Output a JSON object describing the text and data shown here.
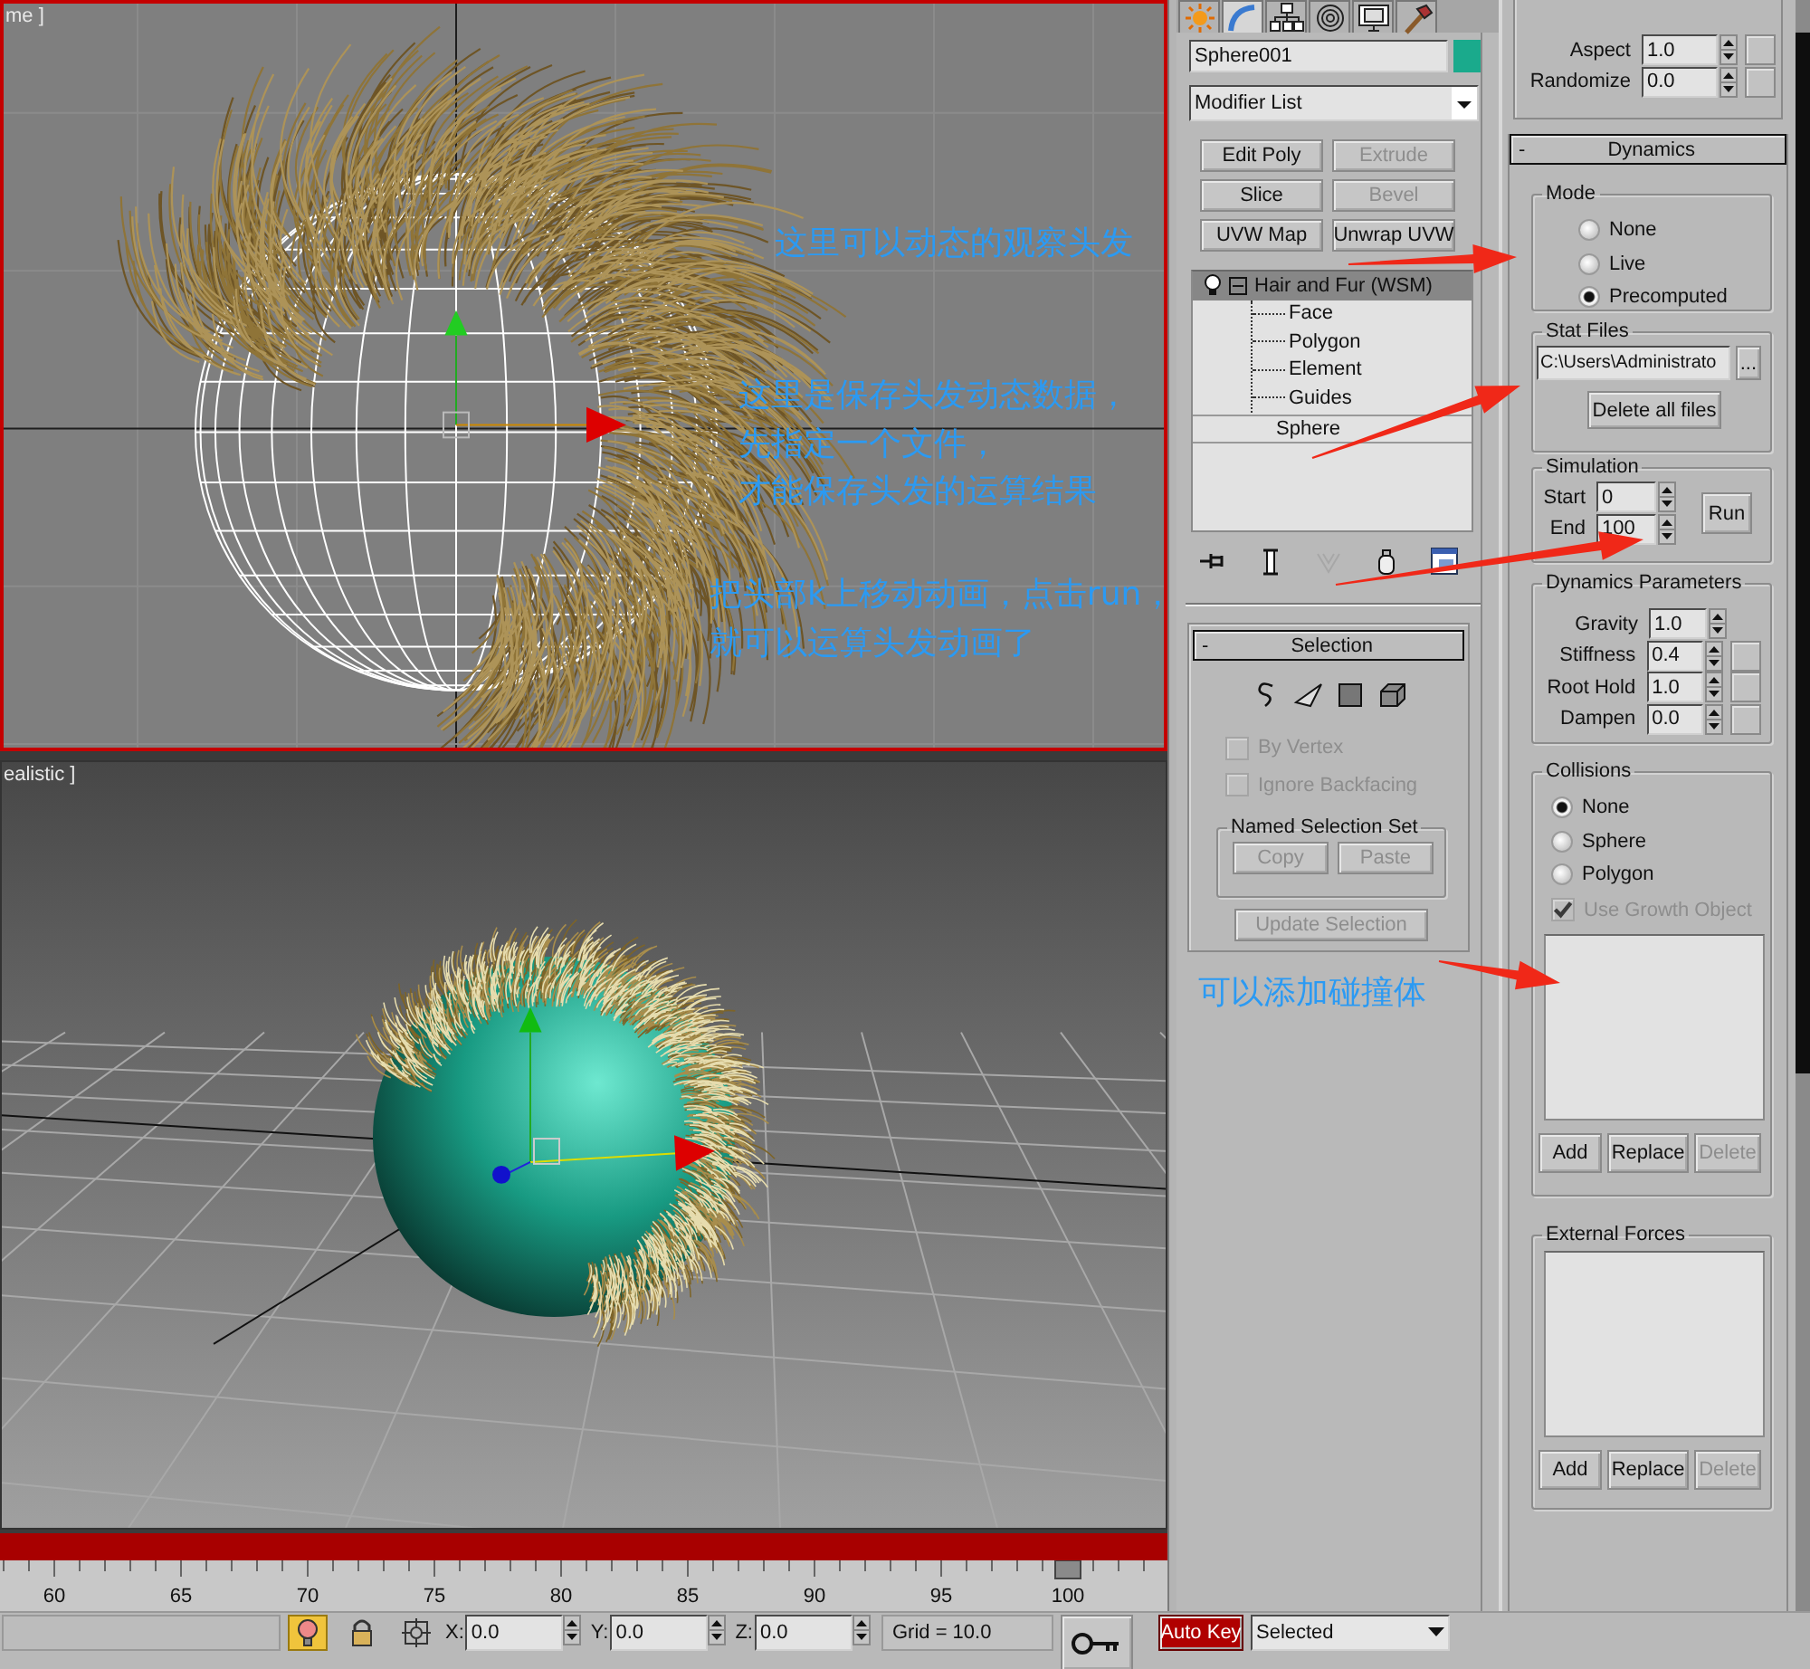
{
  "viewports": [
    {
      "label": "me ]",
      "active": true,
      "kind": "wireframe"
    },
    {
      "label": "ealistic ]",
      "active": false,
      "kind": "shaded"
    }
  ],
  "timeline": {
    "ticks": [
      "60",
      "65",
      "70",
      "75",
      "80",
      "85",
      "90",
      "95",
      "100"
    ]
  },
  "command_panel": {
    "tabs": [
      {
        "kind": "create",
        "selected": false
      },
      {
        "kind": "modify",
        "selected": true
      },
      {
        "kind": "hierarchy",
        "selected": false
      },
      {
        "kind": "motion",
        "selected": false
      },
      {
        "kind": "display",
        "selected": false
      },
      {
        "kind": "utilities",
        "selected": false
      }
    ],
    "object_name": "Sphere001",
    "modifier_list": "Modifier List",
    "modifier_buttons": [
      {
        "label": "Edit Poly",
        "disabled": false
      },
      {
        "label": "Extrude",
        "disabled": true
      },
      {
        "label": "Slice",
        "disabled": false
      },
      {
        "label": "Bevel",
        "disabled": true
      },
      {
        "label": "UVW Map",
        "disabled": false
      },
      {
        "label": "Unwrap UVW",
        "disabled": false
      }
    ],
    "stack": [
      {
        "label": "Hair and Fur (WSM)",
        "selected": true,
        "expanded": true,
        "children": [
          {
            "label": "Face"
          },
          {
            "label": "Polygon"
          },
          {
            "label": "Element"
          },
          {
            "label": "Guides"
          }
        ]
      },
      {
        "label": "Sphere",
        "selected": false
      }
    ],
    "stack_tools": [
      {
        "kind": "pin",
        "disabled": false
      },
      {
        "kind": "end-result",
        "disabled": false
      },
      {
        "kind": "unique",
        "disabled": true
      },
      {
        "kind": "remove",
        "disabled": false
      },
      {
        "kind": "configure",
        "disabled": false
      }
    ],
    "selection_rollout": {
      "collapse": "-",
      "title": "Selection",
      "levels": [
        {
          "kind": "guide"
        },
        {
          "kind": "face"
        },
        {
          "kind": "polygon"
        },
        {
          "kind": "element"
        }
      ],
      "options": [
        {
          "label": "By Vertex",
          "checked": false,
          "disabled": true
        },
        {
          "label": "Ignore Backfacing",
          "checked": false,
          "disabled": true
        }
      ],
      "named_selection_set": {
        "title": "Named Selection Set",
        "buttons": [
          {
            "label": "Copy",
            "disabled": true
          },
          {
            "label": "Paste",
            "disabled": true
          }
        ]
      },
      "update_button": {
        "label": "Update Selection",
        "disabled": true
      }
    }
  },
  "hair_panel": {
    "top_fields": [
      {
        "label": "Aspect",
        "value": "1.0",
        "map_slot": true
      },
      {
        "label": "Randomize",
        "value": "0.0",
        "map_slot": true
      }
    ],
    "dynamics": {
      "collapse": "-",
      "title": "Dynamics",
      "mode": {
        "title": "Mode",
        "options": [
          {
            "label": "None",
            "selected": false
          },
          {
            "label": "Live",
            "selected": false
          },
          {
            "label": "Precomputed",
            "selected": true
          }
        ]
      },
      "stat_files": {
        "title": "Stat Files",
        "path": "C:\\Users\\Administrato",
        "browse": "...",
        "delete_button": "Delete all files"
      },
      "simulation": {
        "title": "Simulation",
        "fields": [
          {
            "label": "Start",
            "value": "0"
          },
          {
            "label": "End",
            "value": "100"
          }
        ],
        "run_button": "Run"
      },
      "parameters": {
        "title": "Dynamics Parameters",
        "fields": [
          {
            "label": "Gravity",
            "value": "1.0",
            "map_slot": false
          },
          {
            "label": "Stiffness",
            "value": "0.4",
            "map_slot": true
          },
          {
            "label": "Root Hold",
            "value": "1.0",
            "map_slot": true
          },
          {
            "label": "Dampen",
            "value": "0.0",
            "map_slot": true
          }
        ]
      },
      "collisions": {
        "title": "Collisions",
        "options": [
          {
            "label": "None",
            "selected": true
          },
          {
            "label": "Sphere",
            "selected": false
          },
          {
            "label": "Polygon",
            "selected": false
          }
        ],
        "use_growth": {
          "label": "Use Growth Object",
          "checked": true,
          "disabled": true
        },
        "buttons": [
          {
            "label": "Add",
            "disabled": false
          },
          {
            "label": "Replace",
            "disabled": false
          },
          {
            "label": "Delete",
            "disabled": true
          }
        ]
      },
      "external_forces": {
        "title": "External Forces",
        "buttons": [
          {
            "label": "Add",
            "disabled": false
          },
          {
            "label": "Replace",
            "disabled": false
          },
          {
            "label": "Delete",
            "disabled": true
          }
        ]
      }
    }
  },
  "status_bar": {
    "tools": [
      {
        "kind": "lightbulb",
        "on": true
      },
      {
        "kind": "lock",
        "on": false
      },
      {
        "kind": "crosshair",
        "on": false
      }
    ],
    "coords": [
      {
        "axis": "X:",
        "value": "0.0"
      },
      {
        "axis": "Y:",
        "value": "0.0"
      },
      {
        "axis": "Z:",
        "value": "0.0"
      }
    ],
    "grid": "Grid = 10.0",
    "auto_key": {
      "label": "Auto Key",
      "on": true
    },
    "key_filter": "Selected"
  },
  "annotations": [
    {
      "lines": [
        "这里可以动态的观察头发"
      ]
    },
    {
      "lines": [
        "这里是保存头发动态数据，",
        "先指定一个文件，",
        "才能保存头发的运算结果"
      ]
    },
    {
      "lines": [
        "把头部k上移动动画，点击run，",
        "就可以运算头发动画了"
      ]
    },
    {
      "lines": [
        "可以添加碰撞体"
      ]
    }
  ]
}
